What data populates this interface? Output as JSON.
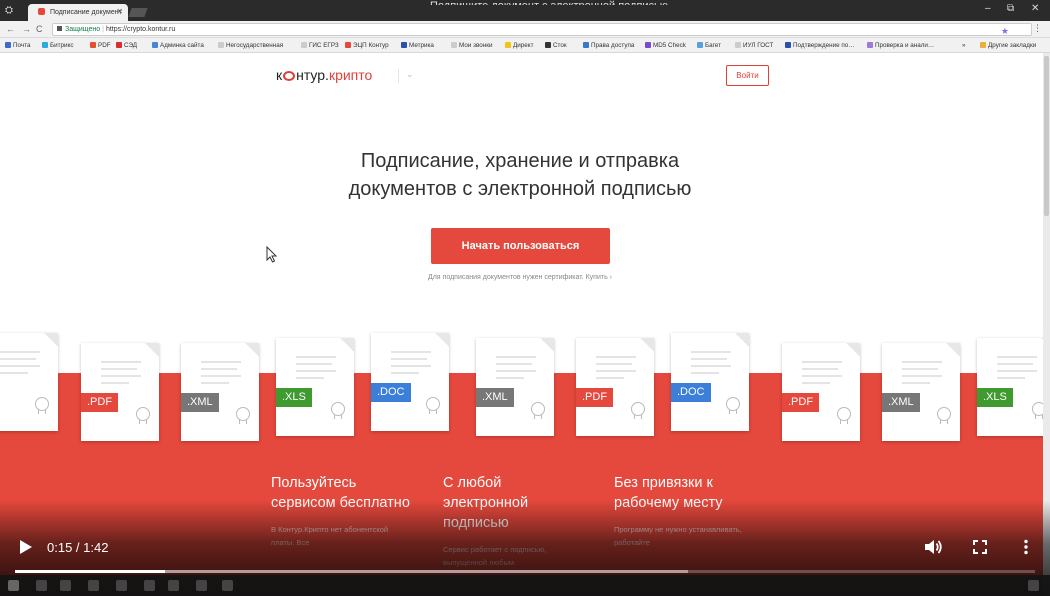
{
  "browser": {
    "window_title": "Подпишите документ с электронной подписью",
    "tab_title": "Подписание документ",
    "url_secure_label": "Защищено",
    "url": "https://crypto.kontur.ru",
    "bookmarks": [
      {
        "label": "Почта",
        "color": "#3b6cc9"
      },
      {
        "label": "Битрикс",
        "color": "#2fa7e0"
      },
      {
        "label": "PDF",
        "color": "#e2522f"
      },
      {
        "label": "СЭД",
        "color": "#d43030"
      },
      {
        "label": "Админка сайта",
        "color": "#4a84d9"
      },
      {
        "label": "Негосударственная",
        "color": "#cccccc"
      },
      {
        "label": "ГИС ЕГРЗ",
        "color": "#cccccc"
      },
      {
        "label": "ЭЦП Контур",
        "color": "#e5483c"
      },
      {
        "label": "Метрика",
        "color": "#2a4fb0"
      },
      {
        "label": "Мои звонки",
        "color": "#cccccc"
      },
      {
        "label": "Директ",
        "color": "#f2c318"
      },
      {
        "label": "Сток",
        "color": "#333333"
      },
      {
        "label": "Права доступа",
        "color": "#3b76c9"
      },
      {
        "label": "MD5 Check",
        "color": "#7a4bd0"
      },
      {
        "label": "Багет",
        "color": "#5aa0e0"
      },
      {
        "label": "ИУЛ ГОСТ",
        "color": "#cccccc"
      },
      {
        "label": "Подтверждение по…",
        "color": "#2a4fb0"
      },
      {
        "label": "Проверка и анали…",
        "color": "#9b7cd8"
      },
      {
        "label": "»",
        "color": ""
      },
      {
        "label": "Другие закладки",
        "color": "#e8b13a"
      }
    ]
  },
  "page": {
    "logo_text_a": "к",
    "logo_text_b": "нтур.",
    "logo_text_c": "крипто",
    "login_label": "Войти",
    "headline_line1": "Подписание, хранение и отправка",
    "headline_line2": "документов с электронной подписью",
    "cta_label": "Начать пользоваться",
    "cert_note": "Для подписания документов нужен сертификат. Купить  ›",
    "documents": [
      {
        "tag": "C",
        "color": "#3b7fd9"
      },
      {
        "tag": ".PDF",
        "color": "#e5483c"
      },
      {
        "tag": ".XML",
        "color": "#777777"
      },
      {
        "tag": ".XLS",
        "color": "#3f9b2f"
      },
      {
        "tag": ".DOC",
        "color": "#3b7fd9"
      },
      {
        "tag": ".XML",
        "color": "#777777"
      },
      {
        "tag": ".PDF",
        "color": "#e5483c"
      },
      {
        "tag": ".DOC",
        "color": "#3b7fd9"
      },
      {
        "tag": ".PDF",
        "color": "#e5483c"
      },
      {
        "tag": ".XML",
        "color": "#777777"
      },
      {
        "tag": ".XLS",
        "color": "#3f9b2f"
      }
    ],
    "features": [
      {
        "title": "Пользуйтесь сервисом бесплатно",
        "text": "В Контур.Крипто нет абонентской платы. Все"
      },
      {
        "title": "С любой электронной подписью",
        "text": "Сервис работает с подписью, выпущенной любым"
      },
      {
        "title": "Без привязки к рабочему месту",
        "text": "Программу не нужно устанавливать, работайте"
      }
    ]
  },
  "video": {
    "time_current": "0:15",
    "time_sep": " / ",
    "time_total": "1:42",
    "progress_fraction": 0.147,
    "buffer_fraction": 0.66
  }
}
